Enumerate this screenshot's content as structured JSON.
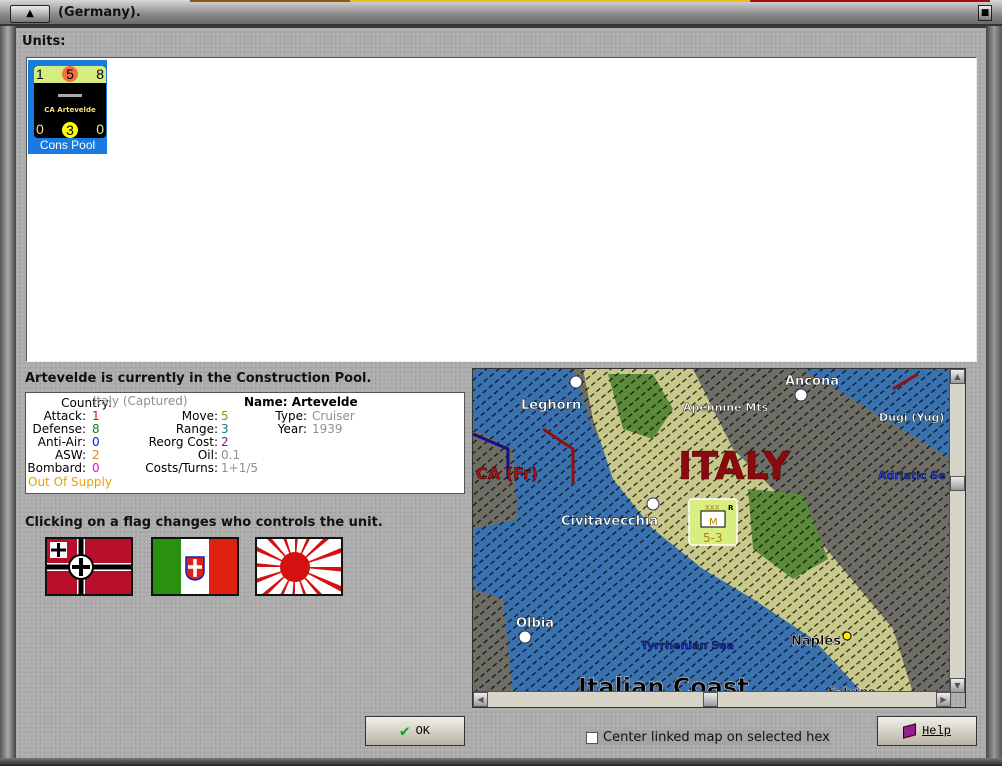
{
  "window": {
    "title": "(Germany)."
  },
  "units": {
    "label": "Units:",
    "items": [
      {
        "name": "CA Artevelde",
        "top": [
          "1",
          "5",
          "8"
        ],
        "bottom": [
          "0",
          "3",
          "0"
        ],
        "caption": "Cons Pool",
        "selected": true
      }
    ]
  },
  "status": "Artevelde is currently in the Construction Pool.",
  "details": {
    "country_label": "Country:",
    "country": "Italy (Captured)",
    "attack_label": "Attack:",
    "attack": "1",
    "defense_label": "Defense:",
    "defense": "8",
    "antiair_label": "Anti-Air:",
    "antiair": "0",
    "asw_label": "ASW:",
    "asw": "2",
    "bombard_label": "Bombard:",
    "bombard": "0",
    "supply": "Out Of Supply",
    "move_label": "Move:",
    "move": "5",
    "range_label": "Range:",
    "range": "3",
    "reorg_label": "Reorg Cost:",
    "reorg": "2",
    "oil_label": "Oil:",
    "oil": "0.1",
    "costs_label": "Costs/Turns:",
    "costs": "1+1/5",
    "name_label": "Name:",
    "name": "Artevelde",
    "type_label": "Type:",
    "type": "Cruiser",
    "year_label": "Year:",
    "year": "1939"
  },
  "flags": {
    "instruction": "Clicking on a flag changes who controls the unit.",
    "items": [
      "Germany",
      "Italy",
      "Japan"
    ]
  },
  "map": {
    "labels": {
      "leghorn": "Leghorn",
      "ancona": "Ancona",
      "apennine": "Apennine Mts",
      "dugi": "Dugi (Yug)",
      "italy": "ITALY",
      "corsica": "CA (Fr)",
      "adriatic": "Adriatic Se",
      "civitavecchia": "Civitavecchia",
      "olbia": "Olbia",
      "tyrrhenian": "Tyrrhenian Sea",
      "naples": "Naples",
      "coast": "Italian Coast",
      "salerno": "Salerno"
    },
    "unit": {
      "size": "XXX",
      "flag": "R",
      "type": "M",
      "strength": "5-3"
    }
  },
  "buttons": {
    "ok": "OK",
    "help": "Help"
  },
  "checkbox": {
    "label": "Center linked map on selected hex",
    "checked": false
  },
  "colors": {
    "selection": "#1a7adf",
    "attack": "#e01010",
    "defense": "#108010",
    "antiair": "#1010e0",
    "asw": "#f08010",
    "bombard": "#e010e0",
    "supply": "#e8a000",
    "move": "#909010",
    "range": "#108080",
    "reorg": "#901090",
    "gray": "#909090"
  }
}
